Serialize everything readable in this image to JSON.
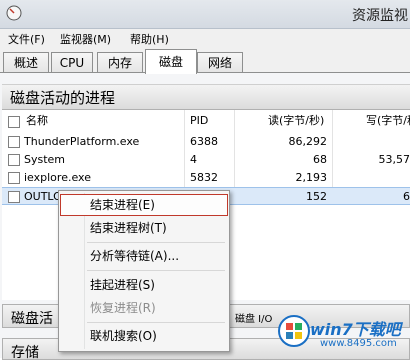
{
  "window": {
    "title": "资源监视"
  },
  "menu": {
    "items": [
      "文件(F)",
      "监视器(M)",
      "帮助(H)"
    ]
  },
  "tabs": {
    "items": [
      "概述",
      "CPU",
      "内存",
      "磁盘",
      "网络"
    ],
    "active": "磁盘"
  },
  "section": {
    "title": "磁盘活动的进程"
  },
  "table": {
    "headers": {
      "name": "名称",
      "pid": "PID",
      "read": "读(字节/秒)",
      "write": "写(字节/秒)"
    },
    "rows": [
      {
        "name": "ThunderPlatform.exe",
        "pid": "6388",
        "read": "86,292",
        "write": ""
      },
      {
        "name": "System",
        "pid": "4",
        "read": "68",
        "write": "53,57"
      },
      {
        "name": "iexplore.exe",
        "pid": "5832",
        "read": "2,193",
        "write": ""
      },
      {
        "name": "OUTLO",
        "pid": "",
        "read": "152",
        "write": "6"
      }
    ]
  },
  "context_menu": {
    "items": [
      {
        "label": "结束进程(E)",
        "state": "hover"
      },
      {
        "label": "结束进程树(T)",
        "state": "normal"
      },
      {
        "label": "分析等待链(A)...",
        "state": "normal"
      },
      {
        "label": "挂起进程(S)",
        "state": "normal"
      },
      {
        "label": "恢复进程(R)",
        "state": "disabled"
      },
      {
        "label": "联机搜索(O)",
        "state": "normal"
      }
    ]
  },
  "bottom": {
    "disk_activity_label": "磁盘活",
    "disk_io_label": "磁盘 I/O",
    "storage_label": "存储"
  },
  "watermark": {
    "text": "win7下载吧",
    "url": "www.8495.com"
  },
  "colors": {
    "hover_border": "#c0392b",
    "selected_row": "#dbe9f9",
    "watermark": "#1a6fc4"
  },
  "icons": {
    "app": "resource-monitor-icon",
    "checkbox": "checkbox-icon",
    "logo": "win7-logo-icon"
  }
}
